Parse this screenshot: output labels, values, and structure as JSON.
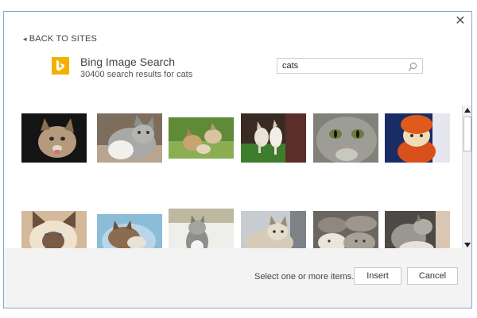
{
  "dialog": {
    "back_label": "BACK TO SITES",
    "close_glyph": "✕"
  },
  "header": {
    "title": "Bing Image Search",
    "subtitle": "30400 search results for cats",
    "logo_color": "#f4b000"
  },
  "search": {
    "value": "cats",
    "icon": "search-icon"
  },
  "results": {
    "items": [
      {
        "row": 1,
        "col": 1,
        "icon": "cat-photo"
      },
      {
        "row": 1,
        "col": 2,
        "icon": "cat-photo"
      },
      {
        "row": 1,
        "col": 3,
        "icon": "cat-photo"
      },
      {
        "row": 1,
        "col": 4,
        "icon": "cat-photo"
      },
      {
        "row": 1,
        "col": 5,
        "icon": "cat-photo"
      },
      {
        "row": 1,
        "col": 6,
        "icon": "cat-photo"
      },
      {
        "row": 2,
        "col": 1,
        "icon": "cat-photo"
      },
      {
        "row": 2,
        "col": 2,
        "icon": "cat-photo"
      },
      {
        "row": 2,
        "col": 3,
        "icon": "cat-photo"
      },
      {
        "row": 2,
        "col": 4,
        "icon": "cat-photo"
      },
      {
        "row": 2,
        "col": 5,
        "icon": "cat-photo"
      },
      {
        "row": 2,
        "col": 6,
        "icon": "cat-photo"
      }
    ]
  },
  "footer": {
    "status": "Select one or more items.",
    "insert_label": "Insert",
    "cancel_label": "Cancel"
  }
}
